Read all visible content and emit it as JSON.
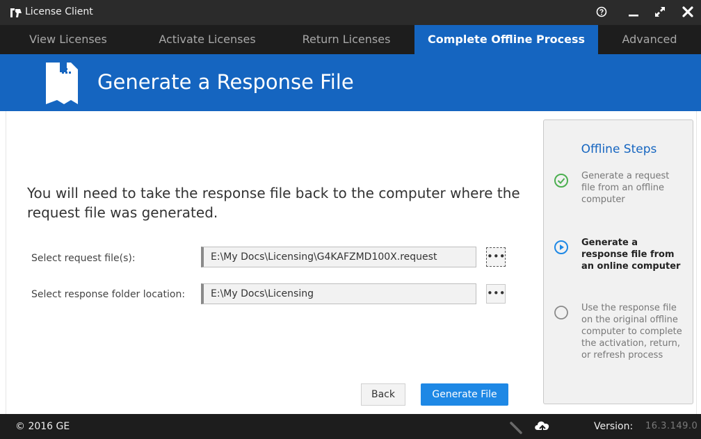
{
  "window": {
    "title": "License Client"
  },
  "tabs": [
    {
      "label": "View Licenses"
    },
    {
      "label": "Activate Licenses"
    },
    {
      "label": "Return Licenses"
    },
    {
      "label": "Complete Offline Process",
      "active": true
    },
    {
      "label": "Advanced"
    }
  ],
  "banner": {
    "title": "Generate a Response File"
  },
  "main": {
    "instruction": "You will need to take the response file back to the computer where the request file was generated.",
    "request_field": {
      "label": "Select request file(s):",
      "value": "E:\\My Docs\\Licensing\\G4KAFZMD100X.request",
      "browse": "•••"
    },
    "response_field": {
      "label": "Select response folder location:",
      "value": "E:\\My Docs\\Licensing",
      "browse": "•••"
    },
    "back_label": "Back",
    "generate_label": "Generate File"
  },
  "steps": {
    "title": "Offline Steps",
    "items": [
      {
        "text": "Generate a request file from an offline computer",
        "status": "done"
      },
      {
        "text": "Generate a response file from an online computer",
        "status": "current"
      },
      {
        "text": "Use the response file on the original offline computer to complete the activation, return, or refresh process",
        "status": "pending"
      }
    ]
  },
  "status_bar": {
    "copyright": "© 2016 GE",
    "version_label": "Version:",
    "version_value": "16.3.149.0"
  },
  "colors": {
    "accent": "#1565c0",
    "button": "#1e88e5",
    "check": "#4caf50",
    "chrome": "#1d1d1d"
  }
}
